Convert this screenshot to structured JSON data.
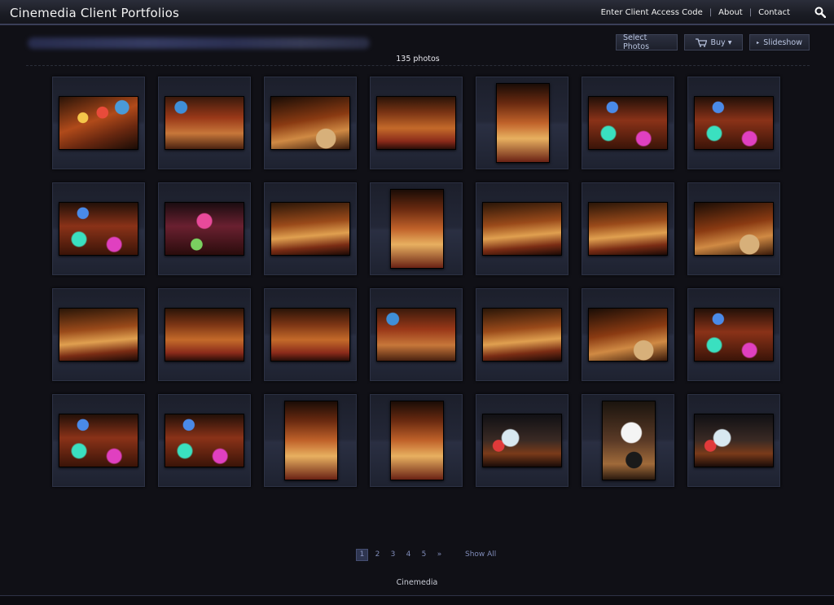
{
  "header": {
    "site_title": "Cinemedia Client Portfolios",
    "nav": [
      {
        "label": "Enter Client Access Code"
      },
      {
        "label": "About"
      },
      {
        "label": "Contact"
      }
    ]
  },
  "gallery": {
    "actions": {
      "select_label": "Select Photos",
      "buy_label": "Buy ▾",
      "slideshow_label": "Slideshow"
    },
    "photo_count": "135 photos"
  },
  "pagination": {
    "pages": [
      "1",
      "2",
      "3",
      "4",
      "5",
      "»"
    ],
    "current": "1",
    "show_all": "Show All"
  },
  "footer": {
    "text": "Cinemedia"
  },
  "colors": {
    "background": "#101016",
    "header_accent": "#3a3f58",
    "link": "#7f8bb8"
  }
}
